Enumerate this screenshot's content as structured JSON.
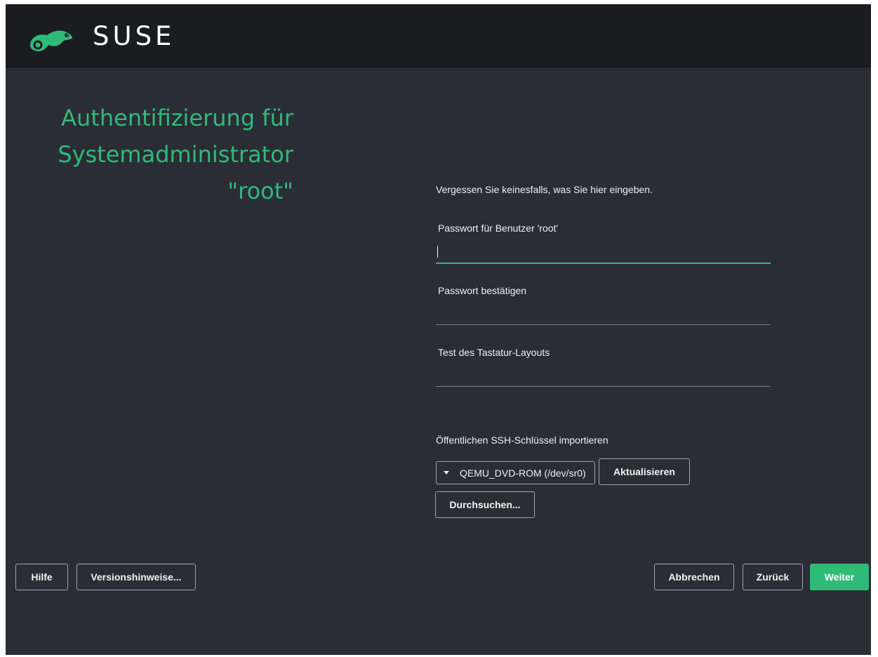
{
  "header": {
    "logo_text": "SUSE",
    "logo_icon": "suse-chameleon-icon"
  },
  "title_lines": [
    "Authentifizierung für",
    "Systemadministrator",
    "\"root\""
  ],
  "form": {
    "hint": "Vergessen Sie keinesfalls, was Sie hier eingeben.",
    "password_label": "Passwort für Benutzer 'root'",
    "password_value": "",
    "confirm_label": "Passwort bestätigen",
    "confirm_value": "",
    "keyboard_test_label": "Test des Tastatur-Layouts",
    "keyboard_test_value": "",
    "ssh_label": "Öffentlichen SSH-Schlüssel importieren",
    "ssh_device_selected": "QEMU_DVD-ROM (/dev/sr0)",
    "refresh_button": "Aktualisieren",
    "browse_button": "Durchsuchen..."
  },
  "footer": {
    "help_button": "Hilfe",
    "release_notes_button": "Versionshinweise...",
    "abort_button": "Abbrechen",
    "back_button": "Zurück",
    "next_button": "Weiter"
  },
  "colors": {
    "accent": "#30ba78",
    "background": "#2a2d36",
    "topbar": "#1b1c21"
  }
}
